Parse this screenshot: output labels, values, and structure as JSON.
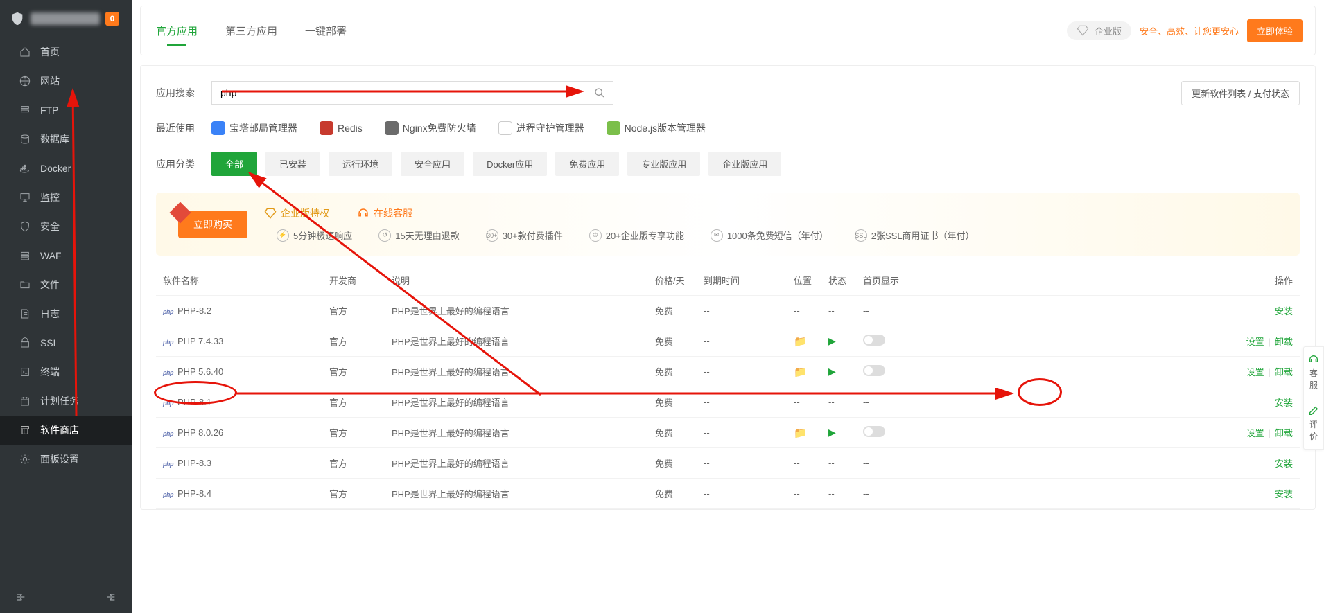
{
  "header": {
    "badge": "0"
  },
  "sidebar": {
    "items": [
      {
        "label": "首页",
        "icon": "home"
      },
      {
        "label": "网站",
        "icon": "globe"
      },
      {
        "label": "FTP",
        "icon": "ftp"
      },
      {
        "label": "数据库",
        "icon": "database"
      },
      {
        "label": "Docker",
        "icon": "docker"
      },
      {
        "label": "监控",
        "icon": "monitor"
      },
      {
        "label": "安全",
        "icon": "shield"
      },
      {
        "label": "WAF",
        "icon": "waf"
      },
      {
        "label": "文件",
        "icon": "folder"
      },
      {
        "label": "日志",
        "icon": "log"
      },
      {
        "label": "SSL",
        "icon": "ssl"
      },
      {
        "label": "终端",
        "icon": "terminal"
      },
      {
        "label": "计划任务",
        "icon": "cron"
      },
      {
        "label": "软件商店",
        "icon": "store",
        "active": true
      },
      {
        "label": "面板设置",
        "icon": "settings"
      }
    ]
  },
  "topbar": {
    "tabs": [
      {
        "label": "官方应用",
        "active": true
      },
      {
        "label": "第三方应用"
      },
      {
        "label": "一键部署"
      }
    ],
    "ent_label": "企业版",
    "promo": "安全、高效、让您更安心",
    "try_btn": "立即体验"
  },
  "search": {
    "label": "应用搜索",
    "value": "php",
    "refresh_btn": "更新软件列表 / 支付状态"
  },
  "recent": {
    "label": "最近使用",
    "items": [
      {
        "name": "宝塔邮局管理器",
        "color": "#3a82f7"
      },
      {
        "name": "Redis",
        "color": "#c73a2e"
      },
      {
        "name": "Nginx免费防火墙",
        "color": "#6b6b6b"
      },
      {
        "name": "进程守护管理器",
        "color": "#ffffff"
      },
      {
        "name": "Node.js版本管理器",
        "color": "#7bbf4a"
      }
    ]
  },
  "categories": {
    "label": "应用分类",
    "items": [
      "全部",
      "已安装",
      "运行环境",
      "安全应用",
      "Docker应用",
      "免费应用",
      "专业版应用",
      "企业版应用"
    ]
  },
  "banner": {
    "buy_btn": "立即购买",
    "priv_label": "企业版特权",
    "cs_label": "在线客服",
    "features": [
      "5分钟极速响应",
      "15天无理由退款",
      "30+款付费插件",
      "20+企业版专享功能",
      "1000条免费短信（年付）",
      "2张SSL商用证书（年付）"
    ]
  },
  "table": {
    "headers": {
      "name": "软件名称",
      "developer": "开发商",
      "desc": "说明",
      "price": "价格/天",
      "expire": "到期时间",
      "position": "位置",
      "status": "状态",
      "home": "首页显示",
      "action": "操作"
    },
    "action_install": "安装",
    "action_settings": "设置",
    "action_uninstall": "卸载",
    "rows": [
      {
        "name": "PHP-8.2",
        "developer": "官方",
        "desc": "PHP是世界上最好的编程语言",
        "price": "免费",
        "expire": "--",
        "installed": false
      },
      {
        "name": "PHP 7.4.33",
        "developer": "官方",
        "desc": "PHP是世界上最好的编程语言",
        "price": "免费",
        "expire": "--",
        "installed": true
      },
      {
        "name": "PHP 5.6.40",
        "developer": "官方",
        "desc": "PHP是世界上最好的编程语言",
        "price": "免费",
        "expire": "--",
        "installed": true
      },
      {
        "name": "PHP-8.1",
        "developer": "官方",
        "desc": "PHP是世界上最好的编程语言",
        "price": "免费",
        "expire": "--",
        "installed": false
      },
      {
        "name": "PHP 8.0.26",
        "developer": "官方",
        "desc": "PHP是世界上最好的编程语言",
        "price": "免费",
        "expire": "--",
        "installed": true
      },
      {
        "name": "PHP-8.3",
        "developer": "官方",
        "desc": "PHP是世界上最好的编程语言",
        "price": "免费",
        "expire": "--",
        "installed": false
      },
      {
        "name": "PHP-8.4",
        "developer": "官方",
        "desc": "PHP是世界上最好的编程语言",
        "price": "免费",
        "expire": "--",
        "installed": false
      }
    ]
  },
  "float": {
    "cs": "客服",
    "fb": "评价"
  }
}
